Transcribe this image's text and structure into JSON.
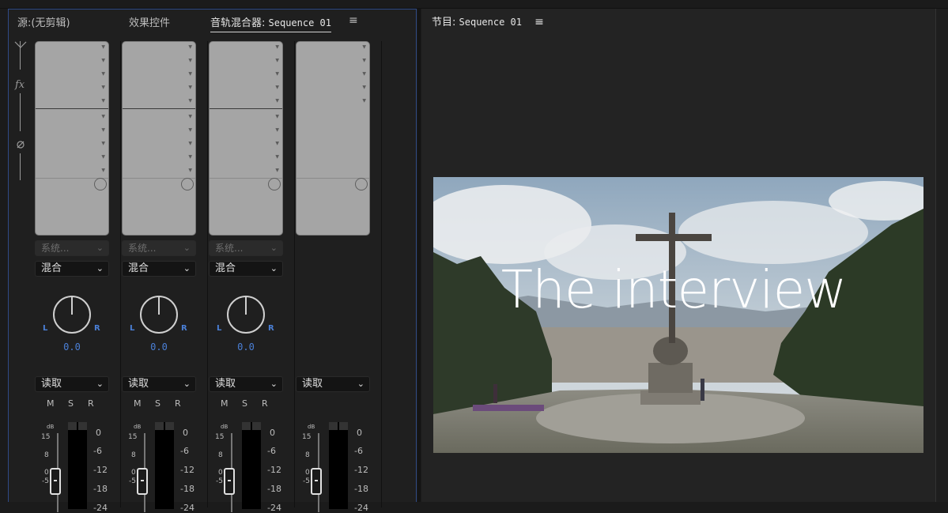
{
  "left_panel": {
    "tabs": [
      {
        "label": "源:(无剪辑)"
      },
      {
        "label": "效果控件"
      },
      {
        "label": "音轨混合器:",
        "sequence": "Sequence 01"
      }
    ],
    "menu_icon": "hamburger-icon",
    "channels": [
      {
        "send": "系统...",
        "mode": "混合",
        "pan_value": "0.0",
        "auto": "读取"
      },
      {
        "send": "系统...",
        "mode": "混合",
        "pan_value": "0.0",
        "auto": "读取"
      },
      {
        "send": "系统...",
        "mode": "混合",
        "pan_value": "0.0",
        "auto": "读取"
      },
      {
        "auto": "读取"
      }
    ],
    "pan_labels": {
      "left": "L",
      "right": "R"
    },
    "msr": {
      "m": "M",
      "s": "S",
      "r": "R"
    },
    "fader_db_label": "dB",
    "fader_scale": [
      "15",
      "8",
      "0",
      "-5"
    ],
    "meter_scale": [
      "0",
      "-6",
      "-12",
      "-18",
      "-24"
    ],
    "meter_scale_last": [
      "0",
      "-6",
      "-12",
      "-18",
      "-24"
    ]
  },
  "right_panel": {
    "tab_label": "节目:",
    "sequence": "Sequence 01",
    "menu_icon": "hamburger-icon",
    "overlay_title": "The interview"
  }
}
